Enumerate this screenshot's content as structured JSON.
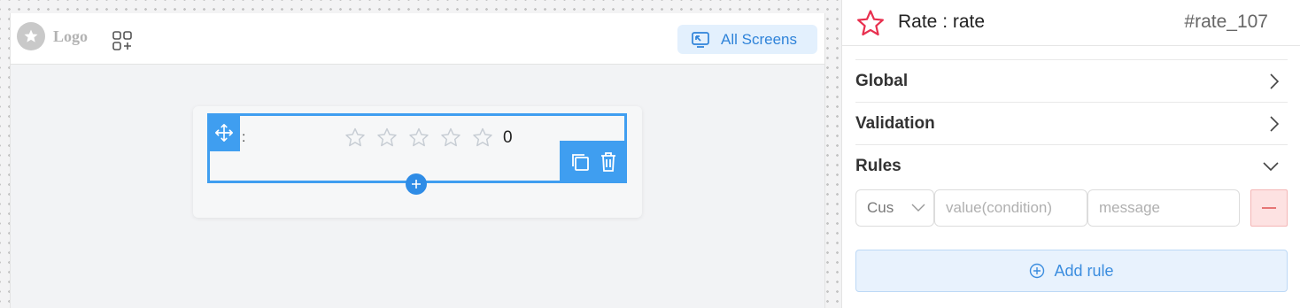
{
  "canvas": {
    "logo_text": "Logo",
    "all_screens_label": "All Screens",
    "rate_field": {
      "label": ":",
      "star_count": 5,
      "rating": 0,
      "value_text": "0"
    }
  },
  "panel": {
    "component_title": "Rate : rate",
    "component_id": "#rate_107",
    "sections": [
      {
        "label": "Global",
        "expanded": false
      },
      {
        "label": "Validation",
        "expanded": false
      },
      {
        "label": "Rules",
        "expanded": true
      }
    ],
    "rules": {
      "type_value": "Cus",
      "condition_placeholder": "value(condition)",
      "message_placeholder": "message",
      "add_rule_label": "Add rule"
    }
  },
  "colors": {
    "accent": "#3f9ef0",
    "star_outline": "#c7cdd4",
    "title_star": "#e8304f",
    "danger_bg": "#fde2e2"
  }
}
